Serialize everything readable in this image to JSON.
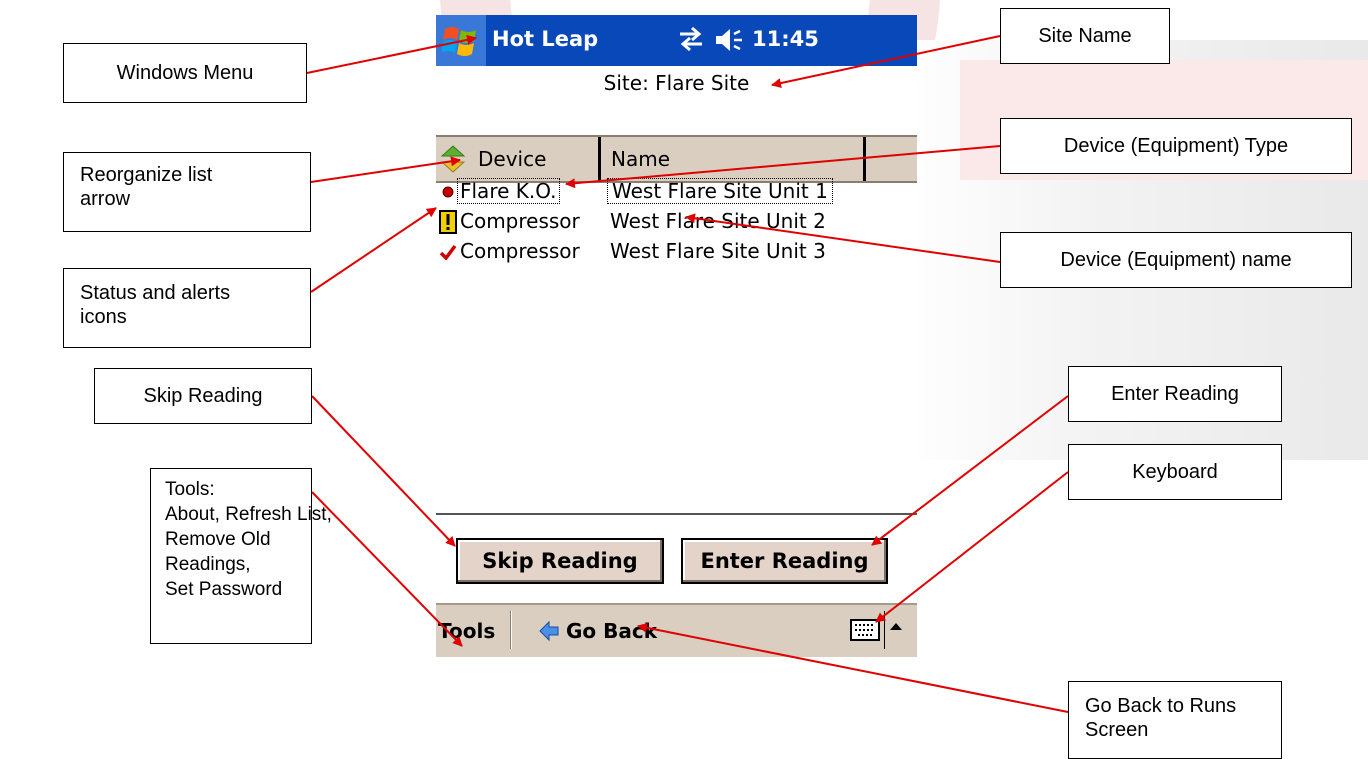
{
  "device": {
    "app_title": "Hot Leap",
    "clock": "11:45",
    "site_label": "Site: Flare Site",
    "columns": [
      "Device",
      "Name"
    ],
    "rows": [
      {
        "status": "red-dot-icon",
        "type": "Flare K.O.",
        "name": "West Flare Site Unit 1",
        "selected": true
      },
      {
        "status": "exclamation-alert-icon",
        "type": "Compressor",
        "name": "West Flare Site Unit 2",
        "selected": false
      },
      {
        "status": "red-check-icon",
        "type": "Compressor",
        "name": "West Flare Site Unit 3",
        "selected": false
      }
    ],
    "buttons": {
      "skip": "Skip Reading",
      "enter": "Enter Reading"
    },
    "menubar": {
      "tools": "Tools",
      "go_back": "Go Back"
    }
  },
  "callouts": {
    "windows_menu": "Windows Menu",
    "site_name": "Site Name",
    "reorganize": [
      "Reorganize list",
      "arrow"
    ],
    "device_type": "Device (Equipment) Type",
    "device_name": "Device (Equipment) name",
    "status_alerts": [
      "Status and alerts",
      "icons"
    ],
    "skip_reading": "Skip Reading",
    "enter_reading": "Enter Reading",
    "keyboard": "Keyboard",
    "tools": [
      "Tools:",
      "About, Refresh List,",
      "Remove Old",
      "Readings,",
      "Set Password"
    ],
    "go_back": [
      "Go Back to Runs",
      "Screen"
    ]
  },
  "colors": {
    "arrow": "#e00000",
    "titlebar": "#0848b8",
    "accent": "#d9cec0"
  }
}
